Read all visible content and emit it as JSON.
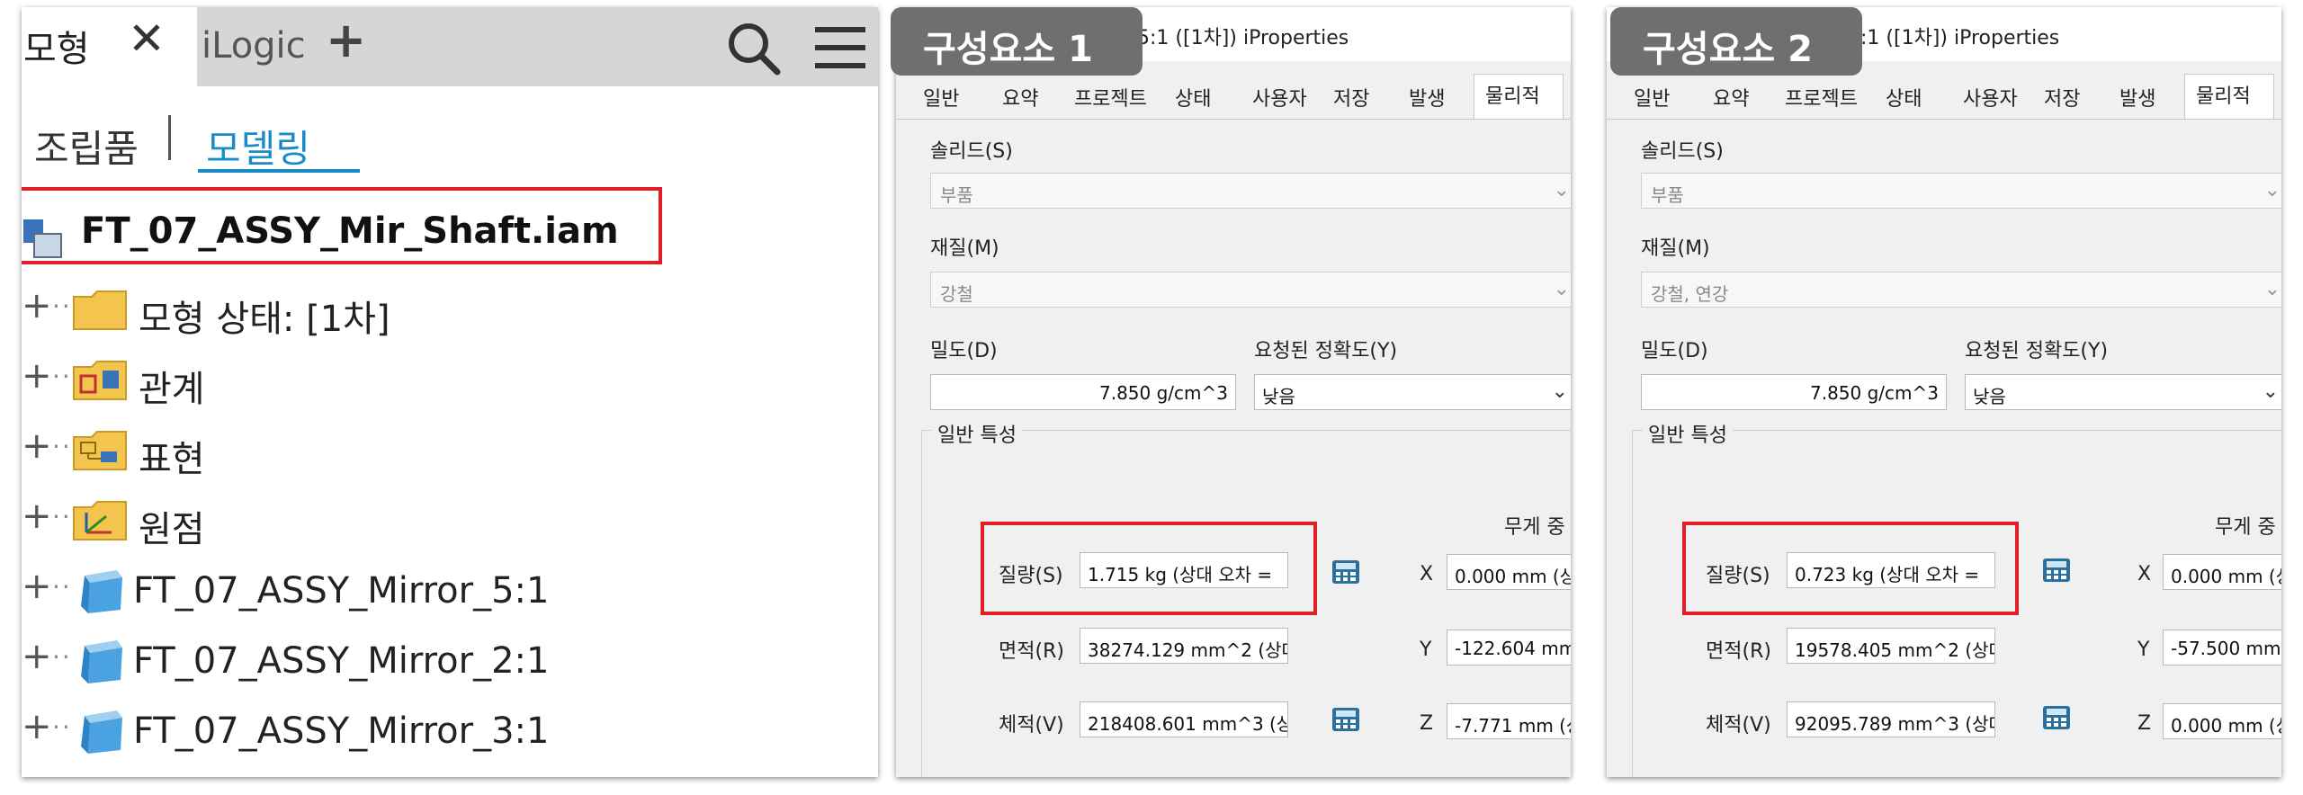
{
  "browser": {
    "tabs": {
      "model": "모형",
      "ilogic": "iLogic"
    },
    "subtabs": {
      "assembly": "조립품",
      "modeling": "모델링"
    },
    "root": {
      "label": "FT_07_ASSY_Mir_Shaft.iam",
      "icon": "assembly-icon"
    },
    "nodes": [
      {
        "label": "모형 상태: [1차]",
        "icon": "folder-icon"
      },
      {
        "label": "관계",
        "icon": "relationships-folder-icon"
      },
      {
        "label": "표현",
        "icon": "representations-folder-icon"
      },
      {
        "label": "원점",
        "icon": "origin-folder-icon"
      },
      {
        "label": "FT_07_ASSY_Mirror_5:1",
        "icon": "part-cube-icon"
      },
      {
        "label": "FT_07_ASSY_Mirror_2:1",
        "icon": "part-cube-icon"
      },
      {
        "label": "FT_07_ASSY_Mirror_3:1",
        "icon": "part-cube-icon"
      }
    ]
  },
  "callouts": {
    "first": "구성요소 1",
    "second": "구성요소 2"
  },
  "props1": {
    "title": "5:1 ([1차]) iProperties",
    "tabs": [
      "일반",
      "요약",
      "프로젝트",
      "상태",
      "사용자",
      "저장",
      "발생",
      "물리적"
    ],
    "solid_label": "솔리드(S)",
    "solid_value": "부품",
    "material_label": "재질(M)",
    "material_value": "강철",
    "density_label": "밀도(D)",
    "density_value": "7.850 g/cm^3",
    "accuracy_label": "요청된 정확도(Y)",
    "accuracy_value": "낮음",
    "general_props": "일반 특성",
    "cog_label": "무게 중",
    "mass_label": "질량(S)",
    "mass_value": "1.715 kg (상대 오차 =",
    "area_label": "면적(R)",
    "area_value": "38274.129 mm^2 (상대",
    "volume_label": "체적(V)",
    "volume_value": "218408.601 mm^3 (상",
    "x_label": "X",
    "x_value": "0.000 mm (상",
    "y_label": "Y",
    "y_value": "-122.604 mm",
    "z_label": "Z",
    "z_value": "-7.771 mm (상"
  },
  "props2": {
    "title": "3:1 ([1차]) iProperties",
    "tabs": [
      "일반",
      "요약",
      "프로젝트",
      "상태",
      "사용자",
      "저장",
      "발생",
      "물리적"
    ],
    "solid_label": "솔리드(S)",
    "solid_value": "부품",
    "material_label": "재질(M)",
    "material_value": "강철, 연강",
    "density_label": "밀도(D)",
    "density_value": "7.850 g/cm^3",
    "accuracy_label": "요청된 정확도(Y)",
    "accuracy_value": "낮음",
    "general_props": "일반 특성",
    "cog_label": "무게 중",
    "mass_label": "질량(S)",
    "mass_value": "0.723 kg (상대 오차 =",
    "area_label": "면적(R)",
    "area_value": "19578.405 mm^2 (상대",
    "volume_label": "체적(V)",
    "volume_value": "92095.789 mm^3 (상대",
    "x_label": "X",
    "x_value": "0.000 mm (상",
    "y_label": "Y",
    "y_value": "-57.500 mm (",
    "z_label": "Z",
    "z_value": "0.000 mm (상"
  },
  "colors": {
    "highlight": "#e21d25",
    "accent": "#1a8bc9",
    "callout": "#6f6f6f"
  }
}
